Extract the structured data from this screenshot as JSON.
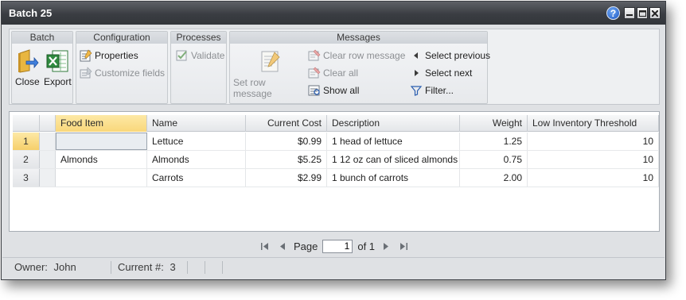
{
  "window": {
    "title": "Batch 25"
  },
  "ribbon": {
    "batch": {
      "header": "Batch",
      "close_label": "Close",
      "export_label": "Export"
    },
    "configuration": {
      "header": "Configuration",
      "properties_label": "Properties",
      "customize_label": "Customize fields"
    },
    "processes": {
      "header": "Processes",
      "validate_label": "Validate"
    },
    "messages": {
      "header": "Messages",
      "set_row_label": "Set row message",
      "clear_row_label": "Clear row message",
      "clear_all_label": "Clear all",
      "show_all_label": "Show all",
      "select_previous_label": "Select previous",
      "select_next_label": "Select next",
      "filter_label": "Filter..."
    }
  },
  "grid": {
    "columns": [
      "Food Item",
      "Name",
      "Current Cost",
      "Description",
      "Weight",
      "Low Inventory Threshold"
    ],
    "rows": [
      {
        "num": "1",
        "food_item": "",
        "name": "Lettuce",
        "cost": "$0.99",
        "description": "1 head of lettuce",
        "weight": "1.25",
        "threshold": "10"
      },
      {
        "num": "2",
        "food_item": "Almonds",
        "name": "Almonds",
        "cost": "$5.25",
        "description": "1 12 oz can of sliced almonds",
        "weight": "0.75",
        "threshold": "10"
      },
      {
        "num": "3",
        "food_item": "",
        "name": "Carrots",
        "cost": "$2.99",
        "description": "1 bunch of carrots",
        "weight": "2.00",
        "threshold": "10"
      }
    ]
  },
  "pager": {
    "page_label": "Page",
    "page_value": "1",
    "of_label": "of 1"
  },
  "status": {
    "owner_label": "Owner:",
    "owner_value": "John",
    "current_label": "Current #:",
    "current_value": "3"
  },
  "colors": {
    "titlebar": "#3a3d42",
    "selected_header": "#f9d77a",
    "accent_blue": "#1d58c7"
  }
}
